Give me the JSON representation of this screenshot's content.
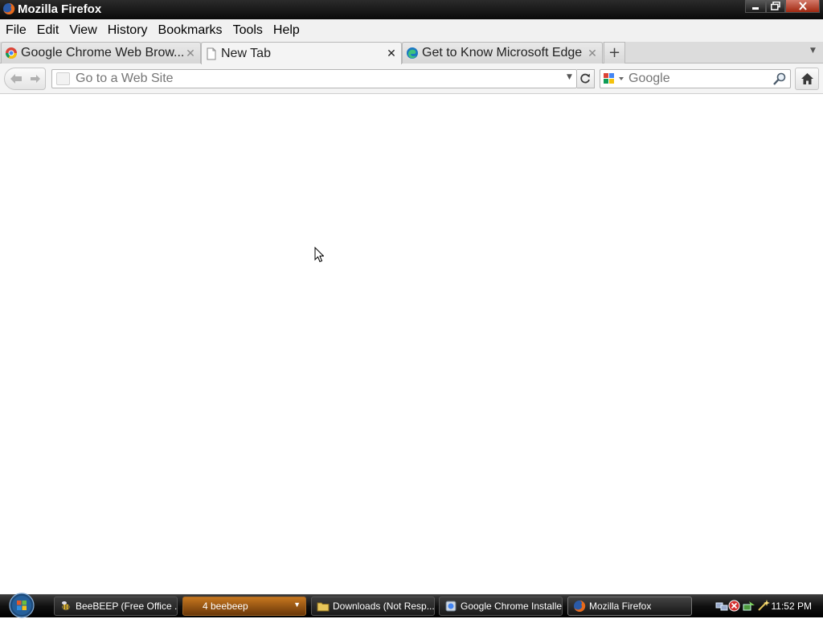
{
  "window": {
    "title": "Mozilla Firefox"
  },
  "menu": [
    "File",
    "Edit",
    "View",
    "History",
    "Bookmarks",
    "Tools",
    "Help"
  ],
  "tabs": [
    {
      "label": "Google Chrome Web Brow...",
      "icon": "chrome-icon",
      "active": false
    },
    {
      "label": "New Tab",
      "icon": "page-icon",
      "active": true
    },
    {
      "label": "Get to Know Microsoft Edge",
      "icon": "edge-icon",
      "active": false
    }
  ],
  "newtab_label": "+",
  "address": {
    "placeholder": "Go to a Web Site",
    "value": ""
  },
  "search": {
    "placeholder": "Google",
    "engine": "google-icon"
  },
  "taskbar": {
    "items": [
      {
        "label": "BeeBEEP (Free Office ...",
        "icon": "beebeep-icon"
      },
      {
        "label": "4  beebeep",
        "icon": "",
        "group": true
      },
      {
        "label": "Downloads (Not Resp...",
        "icon": "folder-icon"
      },
      {
        "label": "Google Chrome Installer",
        "icon": "installer-icon"
      },
      {
        "label": "Mozilla Firefox",
        "icon": "firefox-icon",
        "current": true
      }
    ],
    "clock": "11:52 PM"
  },
  "colors": {
    "titlebar": "#0a0a0a",
    "menubar": "#f1f1f1",
    "group_button": "#c7771f"
  }
}
